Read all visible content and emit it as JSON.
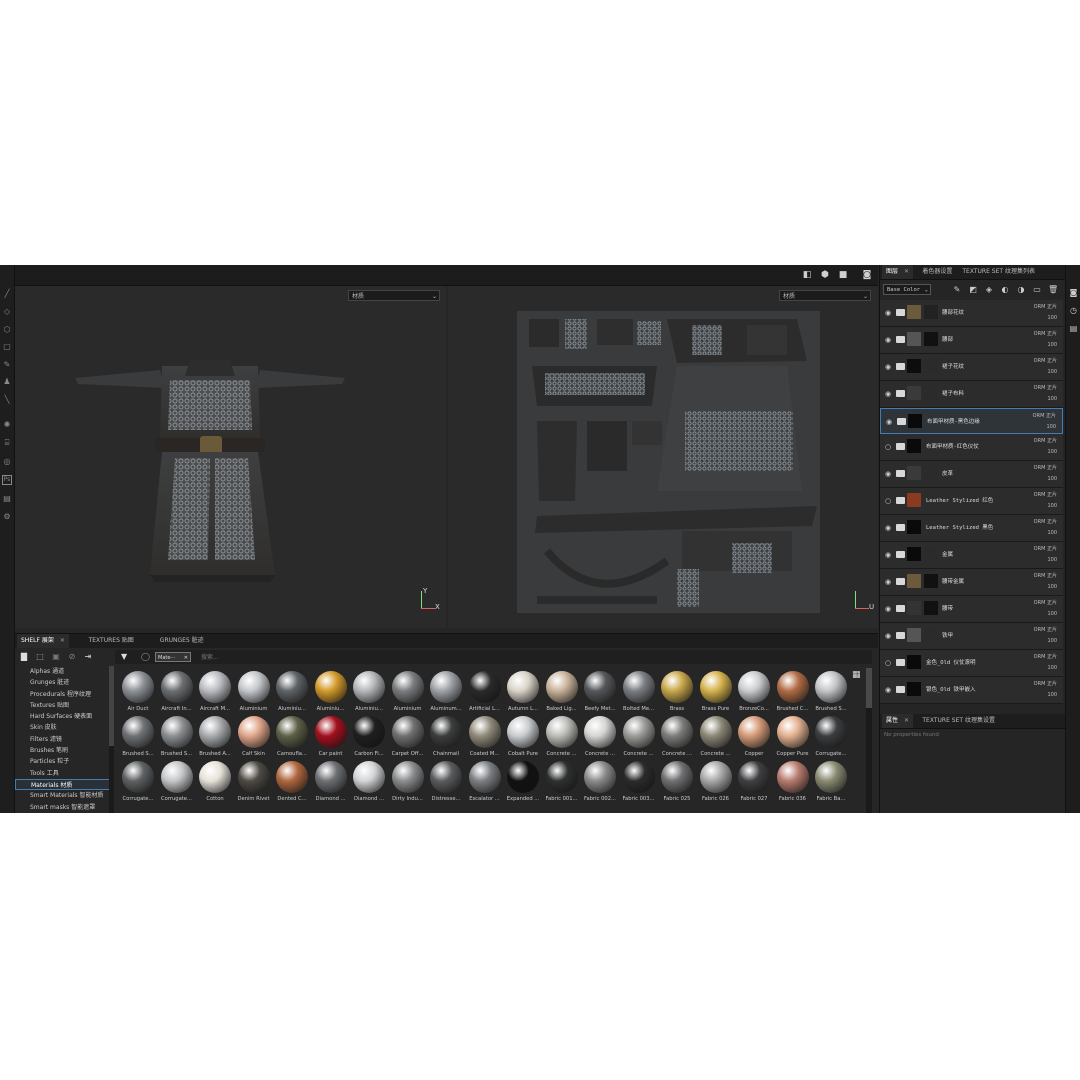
{
  "topbar": {
    "icons": [
      "display-mode-icon",
      "cube-icon",
      "video-icon",
      "camera-icon"
    ]
  },
  "viewport3d": {
    "dropdown": "材质",
    "axis_y": "Y",
    "axis_x": "X"
  },
  "viewport2d": {
    "dropdown": "材质",
    "axis_u": "U"
  },
  "layersPanel": {
    "tabs": [
      {
        "label": "图层",
        "active": true
      },
      {
        "label": "着色器设置",
        "active": false
      },
      {
        "label": "TEXTURE SET 纹理集列表",
        "active": false
      }
    ],
    "channel": "Base Color",
    "layers": [
      {
        "name": "腰部花纹",
        "blend": "ORM 正片",
        "opacity": "100",
        "visible": true,
        "thumb": "#6b5a3c",
        "mask": "#222",
        "selected": false
      },
      {
        "name": "腰部",
        "blend": "ORM 正片",
        "opacity": "100",
        "visible": true,
        "thumb": "#555",
        "mask": "#111",
        "selected": false
      },
      {
        "name": "裙子花纹",
        "blend": "ORM 正片",
        "opacity": "100",
        "visible": true,
        "thumb": "#0d0d0d",
        "mask": "#2b2b2b",
        "selected": false
      },
      {
        "name": "裙子布料",
        "blend": "ORM 正片",
        "opacity": "100",
        "visible": true,
        "thumb": "#3a3a3a",
        "mask": "#2b2b2b",
        "selected": false
      },
      {
        "name": "布面甲材质-黑色边缘",
        "blend": "ORM 正片",
        "opacity": "100",
        "visible": true,
        "thumb": "#0a0a0a",
        "mask": "",
        "selected": true
      },
      {
        "name": "布面甲材质-红色仪仗",
        "blend": "ORM 正片",
        "opacity": "100",
        "visible": false,
        "thumb": "#0a0a0a",
        "mask": "",
        "selected": false
      },
      {
        "name": "皮革",
        "blend": "ORM 正片",
        "opacity": "100",
        "visible": true,
        "thumb": "#3a3a3a",
        "mask": "#2b2b2b",
        "selected": false
      },
      {
        "name": "Leather Stylized 红色",
        "blend": "ORM 正片",
        "opacity": "100",
        "visible": false,
        "thumb": "#8a3a1e",
        "mask": "",
        "selected": false
      },
      {
        "name": "Leather Stylized 黑色",
        "blend": "ORM 正片",
        "opacity": "100",
        "visible": true,
        "thumb": "#0a0a0a",
        "mask": "",
        "selected": false
      },
      {
        "name": "金属",
        "blend": "ORM 正片",
        "opacity": "100",
        "visible": true,
        "thumb": "#0a0a0a",
        "mask": "#2b2b2b",
        "selected": false
      },
      {
        "name": "腰带金属",
        "blend": "ORM 正片",
        "opacity": "100",
        "visible": true,
        "thumb": "#6b5a3c",
        "mask": "#111",
        "selected": false
      },
      {
        "name": "腰带",
        "blend": "ORM 正片",
        "opacity": "100",
        "visible": true,
        "thumb": "#333",
        "mask": "#111",
        "selected": false
      },
      {
        "name": "铁甲",
        "blend": "ORM 正片",
        "opacity": "100",
        "visible": true,
        "thumb": "#555",
        "mask": "#2b2b2b",
        "selected": false
      },
      {
        "name": "金色_Old 仪仗滚明",
        "blend": "ORM 正片",
        "opacity": "100",
        "visible": false,
        "thumb": "#0a0a0a",
        "mask": "",
        "selected": false
      },
      {
        "name": "银色_Old 铁甲嵌入",
        "blend": "ORM 正片",
        "opacity": "100",
        "visible": true,
        "thumb": "#0a0a0a",
        "mask": "",
        "selected": false
      }
    ]
  },
  "propertiesPanel": {
    "tabs": [
      {
        "label": "属性",
        "active": true
      },
      {
        "label": "TEXTURE SET 纹理集设置",
        "active": false
      }
    ],
    "empty": "No properties found"
  },
  "shelf": {
    "tabs": [
      {
        "label": "SHELF 展架",
        "active": true
      },
      {
        "label": "TEXTURES 贴图",
        "active": false
      },
      {
        "label": "GRUNGES 脏迹",
        "active": false
      }
    ],
    "filter_chip": "Mate···",
    "search_placeholder": "搜索...",
    "categories": [
      {
        "label": "Alphas 通道",
        "active": false
      },
      {
        "label": "Grunges 脏迹",
        "active": false
      },
      {
        "label": "Procedurals 程序纹理",
        "active": false
      },
      {
        "label": "Textures 贴图",
        "active": false
      },
      {
        "label": "Hard Surfaces 硬表面",
        "active": false
      },
      {
        "label": "Skin 皮肤",
        "active": false
      },
      {
        "label": "Filters 滤镜",
        "active": false
      },
      {
        "label": "Brushes 笔刷",
        "active": false
      },
      {
        "label": "Particles 粒子",
        "active": false
      },
      {
        "label": "Tools 工具",
        "active": false
      },
      {
        "label": "Materials 材质",
        "active": true
      },
      {
        "label": "Smart Materials 智能材质",
        "active": false
      },
      {
        "label": "Smart masks 智能遮罩",
        "active": false
      }
    ],
    "materials": [
      {
        "label": "Air Duct",
        "color": "#8d9196"
      },
      {
        "label": "Aircraft In...",
        "color": "#6c6f72"
      },
      {
        "label": "Aircraft M...",
        "color": "#b9bcc0"
      },
      {
        "label": "Aluminium",
        "color": "#c3c6ca"
      },
      {
        "label": "Aluminiu...",
        "color": "#5f6366"
      },
      {
        "label": "Aluminiu...",
        "color": "#d39a2a"
      },
      {
        "label": "Aluminiu...",
        "color": "#b4b7ba"
      },
      {
        "label": "Aluminium",
        "color": "#7a7d80"
      },
      {
        "label": "Aluminum...",
        "color": "#9ea2a6"
      },
      {
        "label": "Artificial L...",
        "color": "#2a2a2a"
      },
      {
        "label": "Autumn L...",
        "color": "#d9d2c8"
      },
      {
        "label": "Baked Lig...",
        "color": "#c9b29a"
      },
      {
        "label": "Beefy Met...",
        "color": "#55585b"
      },
      {
        "label": "Bolted Me...",
        "color": "#7b7e82"
      },
      {
        "label": "Brass",
        "color": "#c8a64a"
      },
      {
        "label": "Brass Pure",
        "color": "#d4b24c"
      },
      {
        "label": "BronzeCo...",
        "color": "#c9cbcd"
      },
      {
        "label": "Brushed C...",
        "color": "#b06c45"
      },
      {
        "label": "Brushed S...",
        "color": "#c2c4c6"
      },
      {
        "label": "Brushed S...",
        "color": "#6f7275"
      },
      {
        "label": "Brushed S...",
        "color": "#8c8f92"
      },
      {
        "label": "Brushed A...",
        "color": "#a8abae"
      },
      {
        "label": "Calf Skin",
        "color": "#e0a58a"
      },
      {
        "label": "Camoufla...",
        "color": "#5e6046"
      },
      {
        "label": "Car paint",
        "color": "#a3101e"
      },
      {
        "label": "Carbon Fi...",
        "color": "#1f1f20"
      },
      {
        "label": "Carpet Off...",
        "color": "#707070"
      },
      {
        "label": "Chainmail",
        "color": "#3c3d3e"
      },
      {
        "label": "Coated M...",
        "color": "#8f8a7a"
      },
      {
        "label": "Cobalt Pure",
        "color": "#c9ccd0"
      },
      {
        "label": "Concrete ...",
        "color": "#bdbdb8"
      },
      {
        "label": "Concrete ...",
        "color": "#d5d5d3"
      },
      {
        "label": "Concrete ...",
        "color": "#9b9b98"
      },
      {
        "label": "Concrete ...",
        "color": "#7c7c79"
      },
      {
        "label": "Concrete ...",
        "color": "#8c8776"
      },
      {
        "label": "Copper",
        "color": "#d49a78"
      },
      {
        "label": "Copper Pure",
        "color": "#e2b090"
      },
      {
        "label": "Corrugate...",
        "color": "#3b3d3f"
      },
      {
        "label": "Corrugate...",
        "color": "#5e6163"
      },
      {
        "label": "Corrugate...",
        "color": "#c4c6c8"
      },
      {
        "label": "Cotton",
        "color": "#e5e2d9"
      },
      {
        "label": "Denim Rivet",
        "color": "#4e4a44"
      },
      {
        "label": "Dented C...",
        "color": "#b0673e"
      },
      {
        "label": "Diamond ...",
        "color": "#6d7073"
      },
      {
        "label": "Diamond ...",
        "color": "#d2d4d6"
      },
      {
        "label": "Dirty Indu...",
        "color": "#8a8c8e"
      },
      {
        "label": "Distresse...",
        "color": "#5a5c5e"
      },
      {
        "label": "Escalator ...",
        "color": "#7c7f82"
      },
      {
        "label": "Expanded ...",
        "color": "#111112"
      },
      {
        "label": "Fabric 001...",
        "color": "#2e2f30"
      },
      {
        "label": "Fabric 002...",
        "color": "#8b8b8b"
      },
      {
        "label": "Fabric 003...",
        "color": "#2b2b2b"
      },
      {
        "label": "Fabric 025",
        "color": "#6f6f72"
      },
      {
        "label": "Fabric 026",
        "color": "#a9a8a8"
      },
      {
        "label": "Fabric 027",
        "color": "#3f3f42"
      },
      {
        "label": "Fabric 036",
        "color": "#b77b6f"
      },
      {
        "label": "Fabric Ba...",
        "color": "#8a8a72"
      }
    ]
  }
}
